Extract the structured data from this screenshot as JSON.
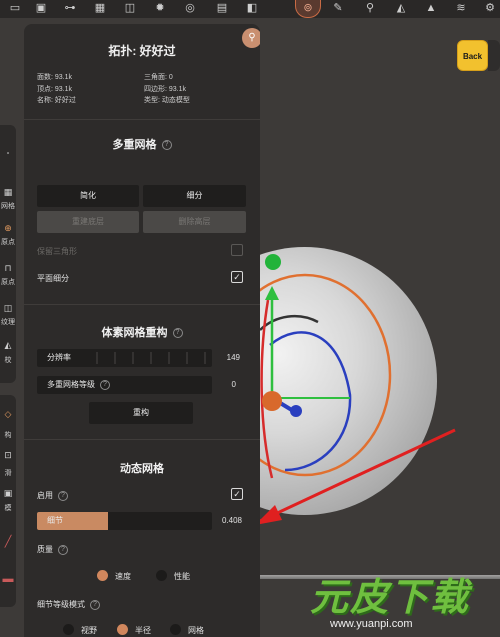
{
  "panel": {
    "title": "拓扑: 好好过",
    "stats": {
      "faces_label": "面数: 93.1k",
      "vertices_label": "顶点: 93.1k",
      "name_label": "名称: 好好过",
      "triangles_label": "三角面: 0",
      "quads_label": "四边形: 93.1k",
      "type_label": "类型: 动态模型"
    },
    "multires": {
      "heading": "多重网格",
      "simplify_label": "简化",
      "subdivide_label": "细分",
      "disabled_btn_left": "重建底层",
      "disabled_btn_right": "删除高层",
      "keep_triangles_label": "保留三角形",
      "keep_triangles_checked": false,
      "flat_subdiv_label": "平面细分",
      "flat_subdiv_checked": true
    },
    "voxel": {
      "heading": "体素网格重构",
      "resolution_label": "分辨率",
      "resolution_value": "149",
      "multires_level_label": "多重网格等级",
      "multires_level_value": "0",
      "remesh_label": "重构"
    },
    "dyntopo": {
      "heading": "动态网格",
      "enable_label": "启用",
      "enable_checked": true,
      "detail_label": "细节",
      "detail_value": "0.408",
      "detail_fraction": 0.408,
      "quality_label": "质量",
      "speed_label": "速度",
      "performance_label": "性能",
      "quality_selected": "速度",
      "detail_mode_label": "细节等级模式",
      "mode_view": "视野",
      "mode_radius": "半径",
      "mode_mesh": "网格",
      "mode_selected": "半径"
    }
  },
  "left_toolbar": {
    "labels": [
      "网格",
      "原点",
      "原点",
      "纹理",
      "校"
    ]
  },
  "left_toolbar2": {
    "labels": [
      "构",
      "滑",
      "模"
    ]
  },
  "back_button": "Back",
  "watermark": {
    "text": "元皮下载",
    "url": "www.yuanpi.com"
  },
  "colors": {
    "accent": "#c98a62",
    "panel_bg": "#2d2b2a",
    "back_button": "#f2c12e",
    "watermark_green": "#6fbf3f"
  }
}
